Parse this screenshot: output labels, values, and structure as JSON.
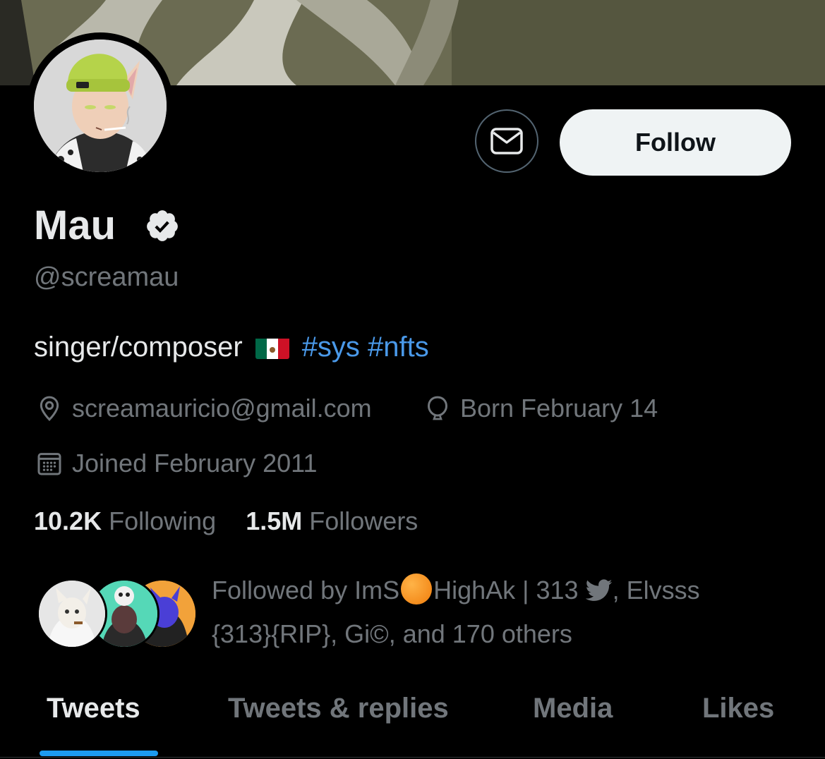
{
  "profile": {
    "display_name": "Mau",
    "handle": "@screamau",
    "bio_text": "singer/composer",
    "bio_hashtags": "#sys #nfts",
    "location": "screamauricio@gmail.com",
    "birthday": "Born February 14",
    "joined": "Joined February 2011"
  },
  "actions": {
    "follow_label": "Follow",
    "message_icon": "envelope-icon"
  },
  "stats": {
    "following_count": "10.2K",
    "following_label": "Following",
    "followers_count": "1.5M",
    "followers_label": "Followers"
  },
  "followed_by": {
    "line1_a": "Followed by ImS",
    "line1_b": "HighAk | 313",
    "line1_c": ", Elvsss",
    "line2": "{313}{RIP}, Gi©, and 170 others"
  },
  "tabs": [
    {
      "label": "Tweets",
      "active": true
    },
    {
      "label": "Tweets & replies",
      "active": false
    },
    {
      "label": "Media",
      "active": false
    },
    {
      "label": "Likes",
      "active": false
    }
  ],
  "colors": {
    "background": "#000000",
    "accent": "#1d9bf0",
    "hashtag": "#4a99e9",
    "secondary_text": "#71767b",
    "follow_button_bg": "#eff3f4"
  }
}
